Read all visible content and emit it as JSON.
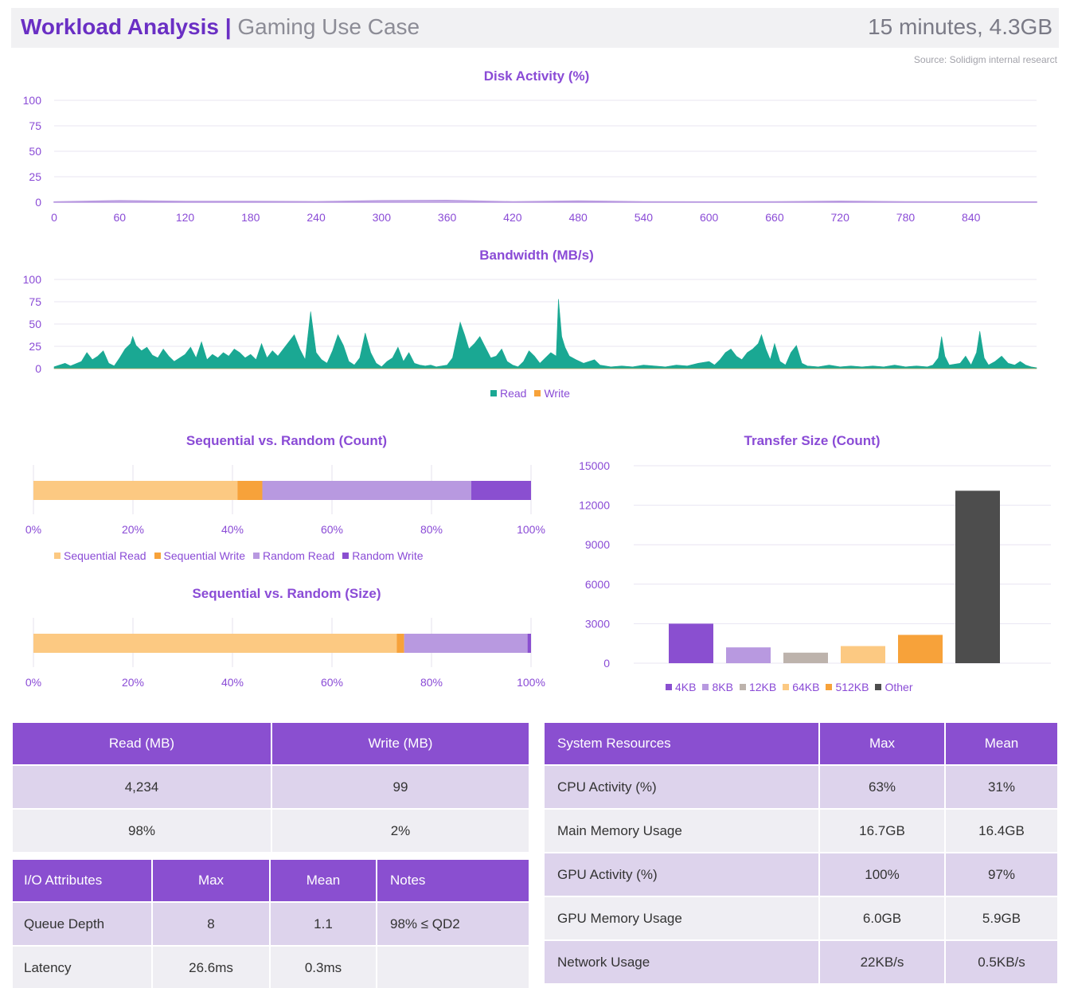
{
  "header": {
    "title": "Workload Analysis |",
    "subtitle": "Gaming Use Case",
    "summary": "15 minutes, 4.3GB",
    "source": "Source: Solidigm internal researct"
  },
  "colors": {
    "purple": "#8a4fd0",
    "read_teal": "#1aa893",
    "write_orange": "#f7a23a",
    "seq_read": "#fcc982",
    "seq_write": "#f7a23a",
    "rand_read": "#b899e0",
    "rand_write": "#8a4fd0",
    "kb4": "#8a4fd0",
    "kb8": "#b899e0",
    "kb12": "#bdb3ac",
    "kb64": "#fcc982",
    "kb512": "#f7a23a",
    "other": "#4d4d4d"
  },
  "chart_data": [
    {
      "id": "disk-activity",
      "type": "area",
      "title": "Disk Activity (%)",
      "xlim": [
        0,
        900
      ],
      "ylim": [
        0,
        100
      ],
      "xticks": [
        "0",
        "60",
        "120",
        "180",
        "240",
        "300",
        "360",
        "420",
        "480",
        "540",
        "600",
        "660",
        "720",
        "780",
        "840"
      ],
      "yticks": [
        "100",
        "75",
        "50",
        "25",
        "0"
      ],
      "series": [
        {
          "values": [
            [
              0,
              0.3
            ],
            [
              60,
              1.5
            ],
            [
              120,
              0.8
            ],
            [
              180,
              0.8
            ],
            [
              240,
              0.5
            ],
            [
              300,
              1.5
            ],
            [
              360,
              1.8
            ],
            [
              420,
              0.4
            ],
            [
              480,
              1.2
            ],
            [
              540,
              0.4
            ],
            [
              600,
              0.3
            ],
            [
              660,
              0.4
            ],
            [
              720,
              1.0
            ],
            [
              780,
              0.4
            ],
            [
              840,
              0.3
            ],
            [
              900,
              0.3
            ]
          ]
        }
      ]
    },
    {
      "id": "bandwidth",
      "type": "area",
      "title": "Bandwidth (MB/s)",
      "xlim": [
        0,
        900
      ],
      "ylim": [
        0,
        100
      ],
      "yticks": [
        "100",
        "75",
        "50",
        "25",
        "0"
      ],
      "series": [
        {
          "name": "Read",
          "values": [
            [
              0,
              2
            ],
            [
              10,
              6
            ],
            [
              15,
              3
            ],
            [
              25,
              8
            ],
            [
              30,
              18
            ],
            [
              35,
              10
            ],
            [
              40,
              14
            ],
            [
              45,
              20
            ],
            [
              50,
              6
            ],
            [
              55,
              3
            ],
            [
              60,
              12
            ],
            [
              65,
              22
            ],
            [
              70,
              28
            ],
            [
              72,
              36
            ],
            [
              75,
              26
            ],
            [
              80,
              20
            ],
            [
              85,
              24
            ],
            [
              90,
              15
            ],
            [
              95,
              12
            ],
            [
              100,
              22
            ],
            [
              105,
              14
            ],
            [
              110,
              8
            ],
            [
              120,
              16
            ],
            [
              125,
              24
            ],
            [
              130,
              12
            ],
            [
              135,
              30
            ],
            [
              140,
              10
            ],
            [
              145,
              16
            ],
            [
              150,
              12
            ],
            [
              155,
              18
            ],
            [
              160,
              14
            ],
            [
              165,
              22
            ],
            [
              170,
              18
            ],
            [
              175,
              12
            ],
            [
              180,
              16
            ],
            [
              185,
              10
            ],
            [
              190,
              28
            ],
            [
              195,
              12
            ],
            [
              200,
              20
            ],
            [
              205,
              14
            ],
            [
              210,
              22
            ],
            [
              220,
              38
            ],
            [
              225,
              22
            ],
            [
              230,
              10
            ],
            [
              235,
              64
            ],
            [
              240,
              18
            ],
            [
              245,
              10
            ],
            [
              250,
              6
            ],
            [
              255,
              20
            ],
            [
              260,
              38
            ],
            [
              265,
              26
            ],
            [
              270,
              8
            ],
            [
              275,
              4
            ],
            [
              280,
              12
            ],
            [
              285,
              40
            ],
            [
              290,
              18
            ],
            [
              295,
              6
            ],
            [
              300,
              2
            ],
            [
              305,
              8
            ],
            [
              310,
              12
            ],
            [
              315,
              24
            ],
            [
              320,
              8
            ],
            [
              325,
              18
            ],
            [
              330,
              6
            ],
            [
              335,
              4
            ],
            [
              340,
              3
            ],
            [
              345,
              4
            ],
            [
              350,
              2
            ],
            [
              360,
              4
            ],
            [
              365,
              12
            ],
            [
              372,
              52
            ],
            [
              376,
              38
            ],
            [
              380,
              22
            ],
            [
              385,
              28
            ],
            [
              390,
              36
            ],
            [
              395,
              24
            ],
            [
              400,
              12
            ],
            [
              405,
              14
            ],
            [
              410,
              22
            ],
            [
              415,
              8
            ],
            [
              420,
              4
            ],
            [
              425,
              2
            ],
            [
              430,
              8
            ],
            [
              435,
              20
            ],
            [
              440,
              14
            ],
            [
              445,
              6
            ],
            [
              450,
              12
            ],
            [
              455,
              18
            ],
            [
              460,
              14
            ],
            [
              462,
              78
            ],
            [
              465,
              36
            ],
            [
              468,
              24
            ],
            [
              472,
              14
            ],
            [
              478,
              10
            ],
            [
              485,
              6
            ],
            [
              490,
              8
            ],
            [
              495,
              10
            ],
            [
              500,
              4
            ],
            [
              510,
              2
            ],
            [
              520,
              3
            ],
            [
              530,
              2
            ],
            [
              540,
              4
            ],
            [
              550,
              3
            ],
            [
              560,
              2
            ],
            [
              570,
              4
            ],
            [
              580,
              3
            ],
            [
              590,
              6
            ],
            [
              600,
              8
            ],
            [
              605,
              4
            ],
            [
              610,
              10
            ],
            [
              615,
              18
            ],
            [
              620,
              22
            ],
            [
              625,
              14
            ],
            [
              630,
              10
            ],
            [
              635,
              18
            ],
            [
              640,
              22
            ],
            [
              645,
              28
            ],
            [
              648,
              38
            ],
            [
              652,
              22
            ],
            [
              656,
              10
            ],
            [
              660,
              28
            ],
            [
              665,
              8
            ],
            [
              670,
              4
            ],
            [
              675,
              18
            ],
            [
              680,
              26
            ],
            [
              685,
              6
            ],
            [
              690,
              3
            ],
            [
              700,
              2
            ],
            [
              710,
              4
            ],
            [
              720,
              2
            ],
            [
              730,
              3
            ],
            [
              740,
              2
            ],
            [
              750,
              3
            ],
            [
              760,
              2
            ],
            [
              770,
              4
            ],
            [
              780,
              2
            ],
            [
              790,
              3
            ],
            [
              800,
              2
            ],
            [
              805,
              4
            ],
            [
              810,
              12
            ],
            [
              813,
              36
            ],
            [
              816,
              14
            ],
            [
              820,
              4
            ],
            [
              830,
              6
            ],
            [
              835,
              14
            ],
            [
              840,
              4
            ],
            [
              845,
              18
            ],
            [
              848,
              42
            ],
            [
              852,
              12
            ],
            [
              856,
              4
            ],
            [
              862,
              8
            ],
            [
              868,
              14
            ],
            [
              874,
              6
            ],
            [
              880,
              4
            ],
            [
              885,
              8
            ],
            [
              890,
              4
            ],
            [
              895,
              2
            ],
            [
              900,
              1
            ]
          ]
        },
        {
          "name": "Write",
          "values": [
            [
              0,
              0
            ],
            [
              900,
              0
            ]
          ]
        }
      ]
    },
    {
      "id": "seq-rand-count",
      "type": "bar",
      "orientation": "horizontal-stacked",
      "title": "Sequential vs. Random (Count)",
      "xlim": [
        0,
        100
      ],
      "xticks": [
        "0%",
        "20%",
        "40%",
        "60%",
        "80%",
        "100%"
      ],
      "series": [
        {
          "name": "Sequential Read",
          "values": [
            41
          ]
        },
        {
          "name": "Sequential Write",
          "values": [
            5
          ]
        },
        {
          "name": "Random Read",
          "values": [
            42
          ]
        },
        {
          "name": "Random Write",
          "values": [
            12
          ]
        }
      ]
    },
    {
      "id": "seq-rand-size",
      "type": "bar",
      "orientation": "horizontal-stacked",
      "title": "Sequential vs. Random (Size)",
      "xlim": [
        0,
        100
      ],
      "xticks": [
        "0%",
        "20%",
        "40%",
        "60%",
        "80%",
        "100%"
      ],
      "series": [
        {
          "name": "Sequential Read",
          "values": [
            73
          ]
        },
        {
          "name": "Sequential Write",
          "values": [
            1.5
          ]
        },
        {
          "name": "Random Read",
          "values": [
            24.8
          ]
        },
        {
          "name": "Random Write",
          "values": [
            0.7
          ]
        }
      ]
    },
    {
      "id": "transfer-size",
      "type": "bar",
      "title": "Transfer Size (Count)",
      "categories": [
        "4KB",
        "8KB",
        "12KB",
        "64KB",
        "512KB",
        "Other"
      ],
      "values": [
        3000,
        1200,
        800,
        1300,
        2150,
        13100
      ],
      "ylim": [
        0,
        15000
      ],
      "yticks": [
        "15000",
        "12000",
        "9000",
        "6000",
        "3000",
        "0"
      ]
    }
  ],
  "legends": {
    "bandwidth": [
      "Read",
      "Write"
    ],
    "seq_count": [
      "Sequential Read",
      "Sequential Write",
      "Random Read",
      "Random Write"
    ],
    "transfer": [
      "4KB",
      "8KB",
      "12KB",
      "64KB",
      "512KB",
      "Other"
    ]
  },
  "rw_table": {
    "headers": [
      "Read (MB)",
      "Write (MB)"
    ],
    "rows": [
      [
        "4,234",
        "99"
      ],
      [
        "98%",
        "2%"
      ]
    ]
  },
  "io_table": {
    "headers": [
      "I/O Attributes",
      "Max",
      "Mean",
      "Notes"
    ],
    "rows": [
      [
        "Queue Depth",
        "8",
        "1.1",
        "98% ≤ QD2"
      ],
      [
        "Latency",
        "26.6ms",
        "0.3ms",
        ""
      ]
    ]
  },
  "sys_table": {
    "headers": [
      "System Resources",
      "Max",
      "Mean"
    ],
    "rows": [
      [
        "CPU Activity (%)",
        "63%",
        "31%"
      ],
      [
        "Main Memory Usage",
        "16.7GB",
        "16.4GB"
      ],
      [
        "GPU Activity (%)",
        "100%",
        "97%"
      ],
      [
        "GPU Memory Usage",
        "6.0GB",
        "5.9GB"
      ],
      [
        "Network Usage",
        "22KB/s",
        "0.5KB/s"
      ]
    ]
  }
}
